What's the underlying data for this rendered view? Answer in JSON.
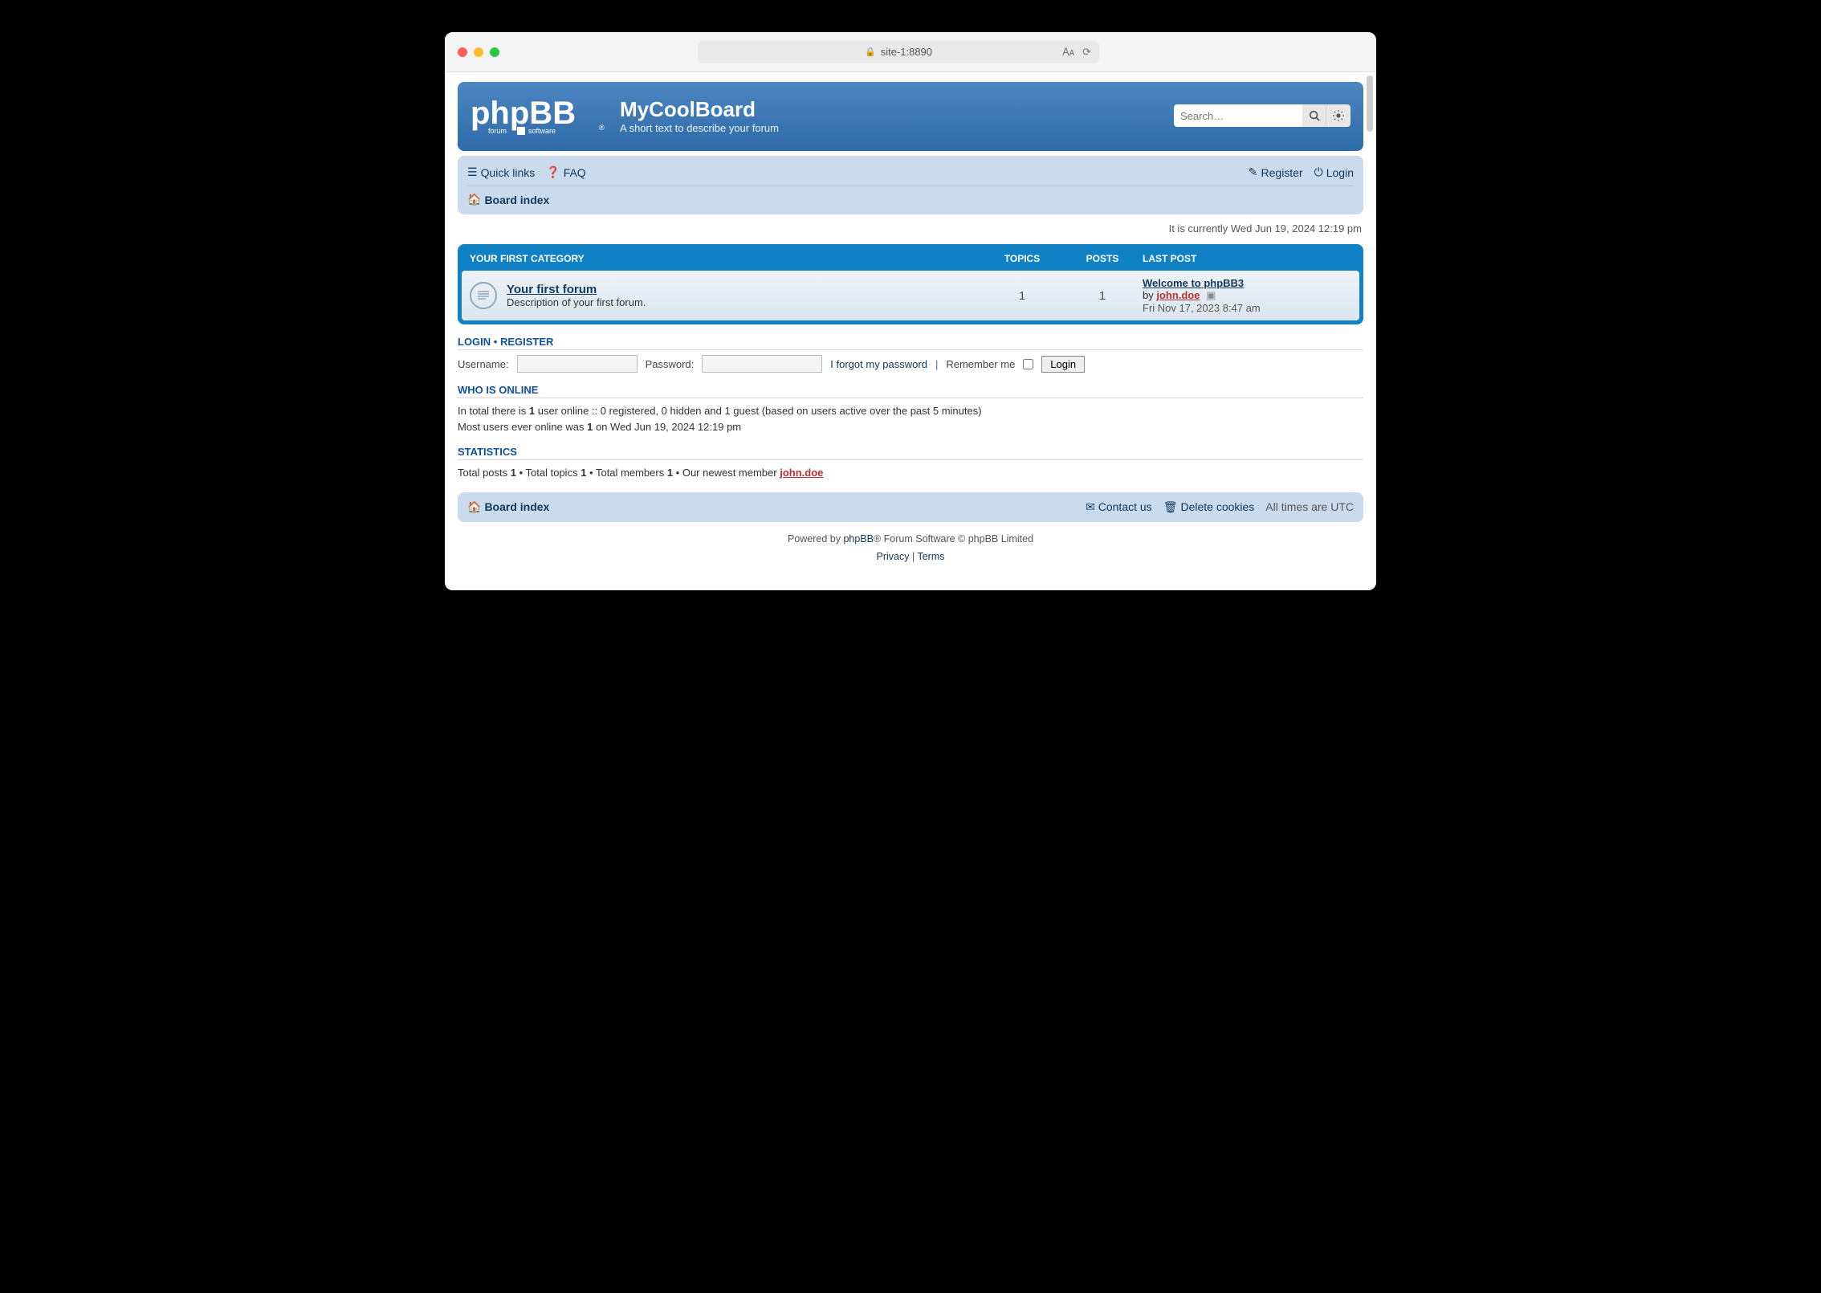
{
  "browser": {
    "url": "site-1:8890"
  },
  "header": {
    "title": "MyCoolBoard",
    "description": "A short text to describe your forum",
    "search_placeholder": "Search…"
  },
  "nav": {
    "quick_links": "Quick links",
    "faq": "FAQ",
    "register": "Register",
    "login": "Login",
    "board_index": "Board index"
  },
  "time_now": "It is currently Wed Jun 19, 2024 12:19 pm",
  "category": {
    "name": "YOUR FIRST CATEGORY",
    "col_topics": "TOPICS",
    "col_posts": "POSTS",
    "col_last": "LAST POST",
    "forums": [
      {
        "title": "Your first forum",
        "desc": "Description of your first forum.",
        "topics": "1",
        "posts": "1",
        "last_title": "Welcome to phpBB3",
        "last_by_prefix": "by ",
        "last_user": "john.doe",
        "last_date": "Fri Nov 17, 2023 8:47 am"
      }
    ]
  },
  "login_section": {
    "heading_login": "LOGIN",
    "heading_sep": "  •  ",
    "heading_register": "REGISTER",
    "username_label": "Username:",
    "password_label": "Password:",
    "forgot": "I forgot my password",
    "remember": "Remember me",
    "login_btn": "Login"
  },
  "who_online": {
    "heading": "WHO IS ONLINE",
    "line1_a": "In total there is ",
    "line1_b": "1",
    "line1_c": " user online :: 0 registered, 0 hidden and 1 guest (based on users active over the past 5 minutes)",
    "line2_a": "Most users ever online was ",
    "line2_b": "1",
    "line2_c": " on Wed Jun 19, 2024 12:19 pm"
  },
  "statistics": {
    "heading": "STATISTICS",
    "posts_label": "Total posts ",
    "posts": "1",
    "topics_label": " • Total topics ",
    "topics": "1",
    "members_label": " • Total members ",
    "members": "1",
    "newest_label": " • Our newest member ",
    "newest_user": "john.doe"
  },
  "footer": {
    "board_index": "Board index",
    "contact": "Contact us",
    "delete_cookies": "Delete cookies",
    "tz_prefix": "All times are ",
    "tz": "UTC"
  },
  "copyright": {
    "powered": "Powered by ",
    "phpbb": "phpBB",
    "suffix": "® Forum Software © phpBB Limited",
    "privacy": "Privacy",
    "sep": " | ",
    "terms": "Terms"
  }
}
